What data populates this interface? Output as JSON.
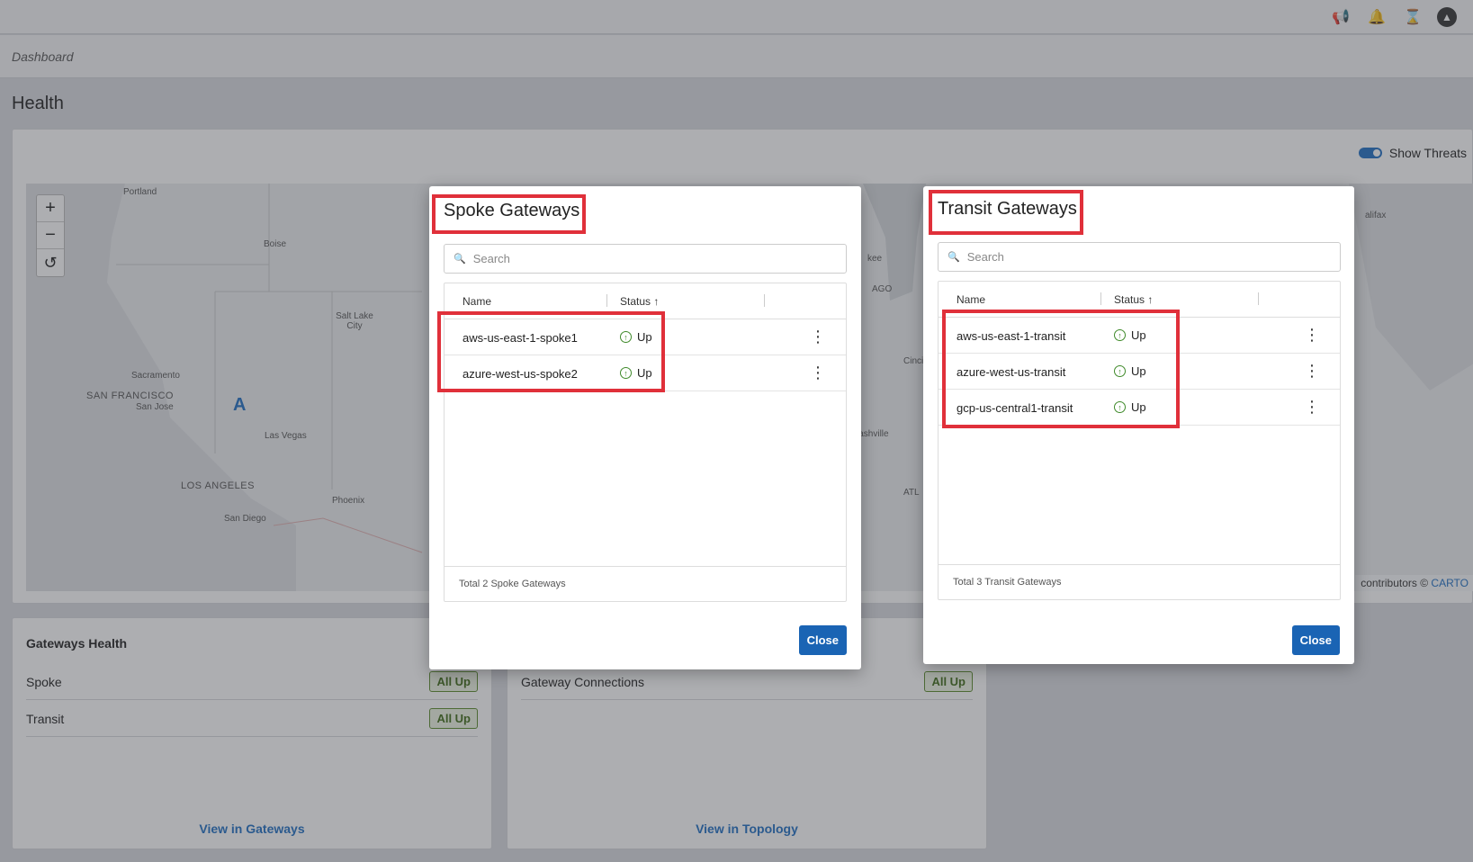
{
  "breadcrumb": "Dashboard",
  "page_title": "Health",
  "show_threats_label": "Show Threats",
  "map": {
    "attribution_prefix": "contributors ©",
    "attribution_link": "CARTO",
    "zoom_in": "+",
    "zoom_out": "−",
    "reset": "↺",
    "labels": [
      "Portland",
      "Boise",
      "Salt Lake City",
      "Sacramento",
      "SAN FRANCISCO",
      "San Jose",
      "Las Vegas",
      "LOS ANGELES",
      "San Diego",
      "Phoenix",
      "Nashville",
      "ATL",
      "AGO",
      "kee",
      "Cinci",
      "alifax"
    ]
  },
  "gateways_health": {
    "title": "Gateways Health",
    "rows": [
      {
        "label": "Spoke",
        "badge": "All Up"
      },
      {
        "label": "Transit",
        "badge": "All Up"
      }
    ],
    "link": "View in Gateways"
  },
  "connections": {
    "row": {
      "label": "Gateway Connections",
      "badge": "All Up"
    },
    "link": "View in Topology"
  },
  "spoke_dialog": {
    "title": "Spoke Gateways",
    "search_placeholder": "Search",
    "columns": {
      "name": "Name",
      "status": "Status ↑"
    },
    "rows": [
      {
        "name": "aws-us-east-1-spoke1",
        "status": "Up"
      },
      {
        "name": "azure-west-us-spoke2",
        "status": "Up"
      }
    ],
    "footer": "Total 2 Spoke Gateways",
    "close": "Close"
  },
  "transit_dialog": {
    "title": "Transit Gateways",
    "search_placeholder": "Search",
    "columns": {
      "name": "Name",
      "status": "Status ↑"
    },
    "rows": [
      {
        "name": "aws-us-east-1-transit",
        "status": "Up"
      },
      {
        "name": "azure-west-us-transit",
        "status": "Up"
      },
      {
        "name": "gcp-us-central1-transit",
        "status": "Up"
      }
    ],
    "footer": "Total 3 Transit Gateways",
    "close": "Close"
  },
  "colors": {
    "accent": "#1a64b4",
    "highlight": "#e0303a",
    "status_up": "#3f8a2a"
  }
}
